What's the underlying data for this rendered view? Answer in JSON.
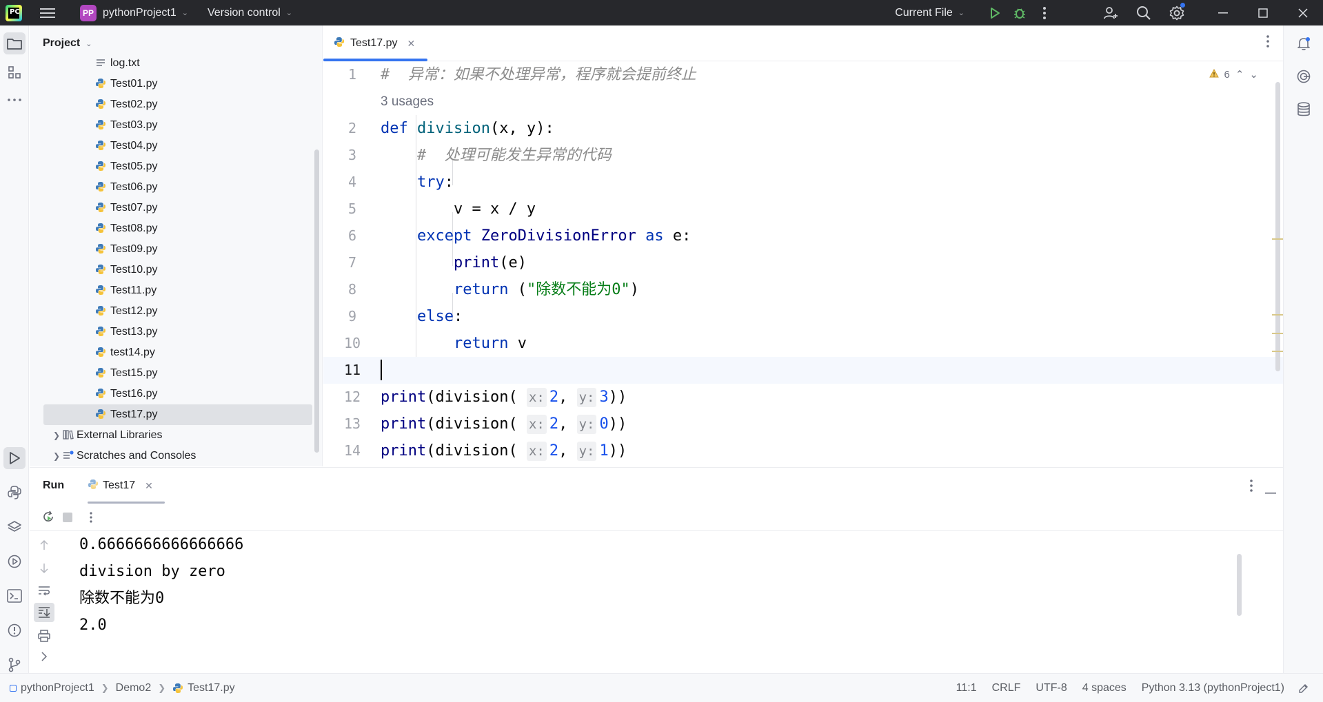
{
  "titlebar": {
    "project_badge": "PP",
    "project_name": "pythonProject1",
    "vcs_label": "Version control",
    "run_config": "Current File"
  },
  "project_panel": {
    "title": "Project",
    "items": [
      {
        "label": "log.txt",
        "type": "txt"
      },
      {
        "label": "Test01.py",
        "type": "py"
      },
      {
        "label": "Test02.py",
        "type": "py"
      },
      {
        "label": "Test03.py",
        "type": "py"
      },
      {
        "label": "Test04.py",
        "type": "py"
      },
      {
        "label": "Test05.py",
        "type": "py"
      },
      {
        "label": "Test06.py",
        "type": "py"
      },
      {
        "label": "Test07.py",
        "type": "py"
      },
      {
        "label": "Test08.py",
        "type": "py"
      },
      {
        "label": "Test09.py",
        "type": "py"
      },
      {
        "label": "Test10.py",
        "type": "py"
      },
      {
        "label": "Test11.py",
        "type": "py"
      },
      {
        "label": "Test12.py",
        "type": "py"
      },
      {
        "label": "Test13.py",
        "type": "py"
      },
      {
        "label": "test14.py",
        "type": "py"
      },
      {
        "label": "Test15.py",
        "type": "py"
      },
      {
        "label": "Test16.py",
        "type": "py"
      },
      {
        "label": "Test17.py",
        "type": "py",
        "selected": true
      }
    ],
    "external_libraries": "External Libraries",
    "scratches": "Scratches and Consoles"
  },
  "editor": {
    "tab_label": "Test17.py",
    "warnings_count": "6",
    "usages_label": "3 usages",
    "line_numbers": [
      "1",
      "2",
      "3",
      "4",
      "5",
      "6",
      "7",
      "8",
      "9",
      "10",
      "11",
      "12",
      "13",
      "14"
    ],
    "lines": {
      "l1_comment": "#  异常：如果不处理异常，程序就会提前终止",
      "l2_def": "def",
      "l2_fn": "division",
      "l2_rest": "(x, y):",
      "l3_comment": "#  处理可能发生异常的代码",
      "l4_try": "try",
      "l4_colon": ":",
      "l5_code": "v = x / y",
      "l6_except": "except",
      "l6_err": "ZeroDivisionError",
      "l6_as": "as",
      "l6_rest": "e:",
      "l7_print": "print",
      "l7_rest": "(e)",
      "l8_return": "return",
      "l8_open": "(",
      "l8_str": "\"除数不能为0\"",
      "l8_close": ")",
      "l9_else": "else",
      "l9_colon": ":",
      "l10_return": "return",
      "l10_rest": "v",
      "print_kw": "print",
      "call_open": "(division(",
      "hint_x": "x:",
      "hint_y": "y:",
      "comma": ",",
      "call_close": "))",
      "l12_x": "2",
      "l12_y": "3",
      "l13_x": "2",
      "l13_y": "0",
      "l14_x": "2",
      "l14_y": "1"
    }
  },
  "run_panel": {
    "title": "Run",
    "tab_label": "Test17",
    "output": [
      "0.6666666666666666",
      "division by zero",
      "除数不能为0",
      "2.0"
    ]
  },
  "statusbar": {
    "breadcrumbs": [
      "pythonProject1",
      "Demo2",
      "Test17.py"
    ],
    "position": "11:1",
    "line_ending": "CRLF",
    "encoding": "UTF-8",
    "indent": "4 spaces",
    "interpreter": "Python 3.13 (pythonProject1)"
  },
  "colors": {
    "accent": "#3574f0",
    "keyword": "#0033b3",
    "string": "#067d17",
    "number": "#1750eb",
    "comment": "#8c8c8c",
    "titlebar_bg": "#27282c"
  }
}
